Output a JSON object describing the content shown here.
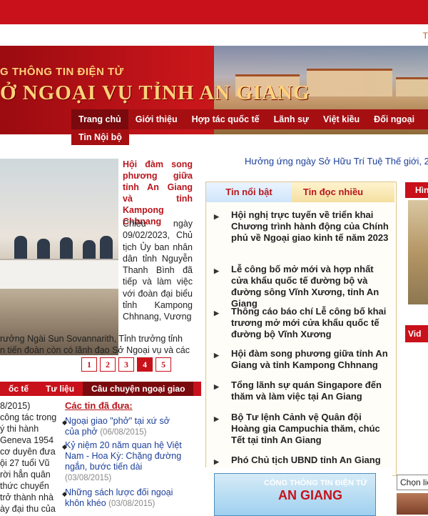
{
  "header": {
    "sub_bar_text": "T",
    "banner_subtitle": "G THÔNG TIN ĐIỆN TỬ",
    "banner_title": "Ở NGOẠI VỤ TỈNH AN GIANG"
  },
  "nav": {
    "items": [
      "Trang chủ",
      "Giới thiệu",
      "Hợp tác quốc tế",
      "Lãnh sự",
      "Việt kiều",
      "Đối ngoại"
    ],
    "second_row": "Tin Nội bộ"
  },
  "ticker": "Hưởng ứng ngày Sở Hữu Trí Tuệ Thế giới, 26 th",
  "feature": {
    "title": "Hội đàm song phương giữa tỉnh An Giang và tỉnh Kampong Chhnang",
    "desc": "Chiều ngày 09/02/2023, Chủ tịch Ủy ban nhân dân tỉnh Nguyễn Thanh Bình đã tiếp và làm việc với đoàn đại biểu tỉnh Kampong Chhnang, Vương",
    "desc_cont_1": "rưởng Ngài Sun Sovannarith, Tỉnh trưởng tỉnh",
    "desc_cont_2": "n tiến đoàn còn có lãnh đạo Sở Ngoại vụ và các",
    "pages": [
      "1",
      "2",
      "3",
      "4",
      "5"
    ],
    "current_page": "4"
  },
  "lower_tabs": [
    "ốc tế",
    "Tư liệu",
    "Câu chuyện ngoại giao"
  ],
  "left_article": {
    "lines": [
      "8/2015)",
      "công tác trong",
      "ý thi hành",
      "Geneva 1954",
      "cơ duyên đưa",
      "ội 27 tuổi Vũ",
      "rời hẳn quân",
      "thức chuyển",
      "trở thành nhà",
      "ày đại thu của"
    ]
  },
  "previous": {
    "heading": "Các tin đã đưa:",
    "items": [
      {
        "text": "Ngoại giao \"phở\" tại xứ sở của phở",
        "date": "(06/08/2015)"
      },
      {
        "text": "Kỷ niệm 20 năm quan hệ Việt Nam - Hoa Kỳ: Chặng đường ngắn, bước tiến dài",
        "date": "(03/08/2015)"
      },
      {
        "text": "Những sách lược đối ngoại khôn khéo",
        "date": "(03/08/2015)"
      }
    ]
  },
  "news_tabs": [
    "Tin nổi bật",
    "Tin đọc nhiều"
  ],
  "news_items": [
    "Hội nghị trực tuyến về triển khai Chương trình hành động của Chính phủ về Ngoại giao kinh tế năm 2023",
    "Lễ công bố mở mới và hợp nhất cửa khẩu quốc tế đường bộ và đường sông Vĩnh Xương, tỉnh An Giang",
    "Thông cáo báo chí Lễ công bố khai trương mở mới cửa khẩu quốc tế đường bộ Vĩnh Xương",
    "Hội đàm song phương giữa tỉnh An Giang và tỉnh Kampong Chhnang",
    "Tổng lãnh sự quán Singapore đến thăm và làm việc tại An Giang",
    "Bộ Tư lệnh Cảnh vệ Quân đội Hoàng gia Campuchia thăm, chúc Tết tại tỉnh An Giang",
    "Phó Chủ tịch UBND tỉnh An Giang"
  ],
  "logo_banner": {
    "top": "CỔNG THÔNG TIN ĐIỆN TỬ",
    "name": "AN GIANG"
  },
  "right": {
    "head": "Hìn",
    "video": "Vid",
    "select_label": "Chọn liê"
  }
}
